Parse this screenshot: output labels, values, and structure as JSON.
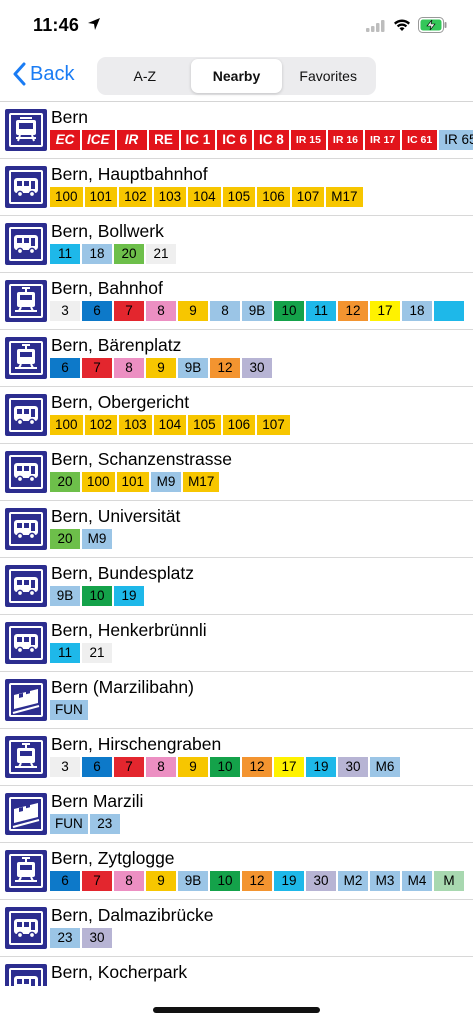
{
  "status": {
    "time": "11:46"
  },
  "nav": {
    "back_label": "Back",
    "tabs": [
      {
        "label": "A-Z",
        "active": false
      },
      {
        "label": "Nearby",
        "active": true
      },
      {
        "label": "Favorites",
        "active": false
      }
    ]
  },
  "colors": {
    "accent": "#1a7cf4",
    "icon_bg": "#2c2d8f",
    "sbb_red": "#e2141b"
  },
  "stops": [
    {
      "name": "Bern",
      "icon": "train-icon",
      "lines": [
        {
          "t": "EC",
          "c": "#e2141b",
          "cls": "red italic"
        },
        {
          "t": "ICE",
          "c": "#e2141b",
          "cls": "red italic"
        },
        {
          "t": "IR",
          "c": "#e2141b",
          "cls": "red italic"
        },
        {
          "t": "RE",
          "c": "#e2141b",
          "cls": "red"
        },
        {
          "t": "IC 1",
          "c": "#e2141b",
          "cls": "red"
        },
        {
          "t": "IC 6",
          "c": "#e2141b",
          "cls": "red"
        },
        {
          "t": "IC 8",
          "c": "#e2141b",
          "cls": "red"
        },
        {
          "t": "IR 15",
          "c": "#e2141b",
          "cls": "red small"
        },
        {
          "t": "IR 16",
          "c": "#e2141b",
          "cls": "red small"
        },
        {
          "t": "IR 17",
          "c": "#e2141b",
          "cls": "red small"
        },
        {
          "t": "IC 61",
          "c": "#e2141b",
          "cls": "red small"
        },
        {
          "t": "IR 65",
          "c": "#9bc5e6",
          "cls": "small"
        },
        {
          "t": "",
          "c": "#1a3a8c",
          "cls": ""
        }
      ]
    },
    {
      "name": "Bern, Hauptbahnhof",
      "icon": "bus-icon",
      "lines": [
        {
          "t": "100",
          "c": "#f7c600"
        },
        {
          "t": "101",
          "c": "#f7c600"
        },
        {
          "t": "102",
          "c": "#f7c600"
        },
        {
          "t": "103",
          "c": "#f7c600"
        },
        {
          "t": "104",
          "c": "#f7c600"
        },
        {
          "t": "105",
          "c": "#f7c600"
        },
        {
          "t": "106",
          "c": "#f7c600"
        },
        {
          "t": "107",
          "c": "#f7c600"
        },
        {
          "t": "M17",
          "c": "#f7c600"
        }
      ]
    },
    {
      "name": "Bern, Bollwerk",
      "icon": "bus-icon",
      "lines": [
        {
          "t": "11",
          "c": "#1eb8e9"
        },
        {
          "t": "18",
          "c": "#9bc5e6"
        },
        {
          "t": "20",
          "c": "#6dbf4a"
        },
        {
          "t": "21",
          "c": "#efefef"
        }
      ]
    },
    {
      "name": "Bern, Bahnhof",
      "icon": "tram-icon",
      "lines": [
        {
          "t": "3",
          "c": "#efefef"
        },
        {
          "t": "6",
          "c": "#0d79c9"
        },
        {
          "t": "7",
          "c": "#e3262e"
        },
        {
          "t": "8",
          "c": "#ec8fc2"
        },
        {
          "t": "9",
          "c": "#f7c600"
        },
        {
          "t": "8",
          "c": "#9bc5e6"
        },
        {
          "t": "9B",
          "c": "#9bc5e6"
        },
        {
          "t": "10",
          "c": "#14a24a"
        },
        {
          "t": "11",
          "c": "#1eb8e9"
        },
        {
          "t": "12",
          "c": "#f39430"
        },
        {
          "t": "17",
          "c": "#fff200"
        },
        {
          "t": "18",
          "c": "#9bc5e6"
        },
        {
          "t": "",
          "c": "#1eb8e9"
        }
      ]
    },
    {
      "name": "Bern, Bärenplatz",
      "icon": "tram-icon",
      "lines": [
        {
          "t": "6",
          "c": "#0d79c9"
        },
        {
          "t": "7",
          "c": "#e3262e"
        },
        {
          "t": "8",
          "c": "#ec8fc2"
        },
        {
          "t": "9",
          "c": "#f7c600"
        },
        {
          "t": "9B",
          "c": "#9bc5e6"
        },
        {
          "t": "12",
          "c": "#f39430"
        },
        {
          "t": "30",
          "c": "#b7b4d4"
        }
      ]
    },
    {
      "name": "Bern, Obergericht",
      "icon": "bus-icon",
      "lines": [
        {
          "t": "100",
          "c": "#f7c600"
        },
        {
          "t": "102",
          "c": "#f7c600"
        },
        {
          "t": "103",
          "c": "#f7c600"
        },
        {
          "t": "104",
          "c": "#f7c600"
        },
        {
          "t": "105",
          "c": "#f7c600"
        },
        {
          "t": "106",
          "c": "#f7c600"
        },
        {
          "t": "107",
          "c": "#f7c600"
        }
      ]
    },
    {
      "name": "Bern, Schanzenstrasse",
      "icon": "bus-icon",
      "lines": [
        {
          "t": "20",
          "c": "#6dbf4a"
        },
        {
          "t": "100",
          "c": "#f7c600"
        },
        {
          "t": "101",
          "c": "#f7c600"
        },
        {
          "t": "M9",
          "c": "#9bc5e6"
        },
        {
          "t": "M17",
          "c": "#f7c600"
        }
      ]
    },
    {
      "name": "Bern, Universität",
      "icon": "bus-icon",
      "lines": [
        {
          "t": "20",
          "c": "#6dbf4a"
        },
        {
          "t": "M9",
          "c": "#9bc5e6"
        }
      ]
    },
    {
      "name": "Bern, Bundesplatz",
      "icon": "bus-icon",
      "lines": [
        {
          "t": "9B",
          "c": "#9bc5e6"
        },
        {
          "t": "10",
          "c": "#14a24a"
        },
        {
          "t": "19",
          "c": "#1eb8e9"
        }
      ]
    },
    {
      "name": "Bern, Henkerbrünnli",
      "icon": "bus-icon",
      "lines": [
        {
          "t": "11",
          "c": "#1eb8e9"
        },
        {
          "t": "21",
          "c": "#efefef"
        }
      ]
    },
    {
      "name": "Bern (Marzilibahn)",
      "icon": "funicular-icon",
      "lines": [
        {
          "t": "FUN",
          "c": "#9bc5e6"
        }
      ]
    },
    {
      "name": "Bern, Hirschengraben",
      "icon": "tram-icon",
      "lines": [
        {
          "t": "3",
          "c": "#efefef"
        },
        {
          "t": "6",
          "c": "#0d79c9"
        },
        {
          "t": "7",
          "c": "#e3262e"
        },
        {
          "t": "8",
          "c": "#ec8fc2"
        },
        {
          "t": "9",
          "c": "#f7c600"
        },
        {
          "t": "10",
          "c": "#14a24a"
        },
        {
          "t": "12",
          "c": "#f39430"
        },
        {
          "t": "17",
          "c": "#fff200"
        },
        {
          "t": "19",
          "c": "#1eb8e9"
        },
        {
          "t": "30",
          "c": "#b7b4d4"
        },
        {
          "t": "M6",
          "c": "#9bc5e6"
        }
      ]
    },
    {
      "name": "Bern Marzili",
      "icon": "funicular-icon",
      "lines": [
        {
          "t": "FUN",
          "c": "#9bc5e6"
        },
        {
          "t": "23",
          "c": "#9bc5e6"
        }
      ]
    },
    {
      "name": "Bern, Zytglogge",
      "icon": "tram-icon",
      "lines": [
        {
          "t": "6",
          "c": "#0d79c9"
        },
        {
          "t": "7",
          "c": "#e3262e"
        },
        {
          "t": "8",
          "c": "#ec8fc2"
        },
        {
          "t": "9",
          "c": "#f7c600"
        },
        {
          "t": "9B",
          "c": "#9bc5e6"
        },
        {
          "t": "10",
          "c": "#14a24a"
        },
        {
          "t": "12",
          "c": "#f39430"
        },
        {
          "t": "19",
          "c": "#1eb8e9"
        },
        {
          "t": "30",
          "c": "#b7b4d4"
        },
        {
          "t": "M2",
          "c": "#9bc5e6"
        },
        {
          "t": "M3",
          "c": "#9bc5e6"
        },
        {
          "t": "M4",
          "c": "#9bc5e6"
        },
        {
          "t": "M",
          "c": "#a8d8b0"
        }
      ]
    },
    {
      "name": "Bern, Dalmazibrücke",
      "icon": "bus-icon",
      "lines": [
        {
          "t": "23",
          "c": "#9bc5e6"
        },
        {
          "t": "30",
          "c": "#b7b4d4"
        }
      ]
    },
    {
      "name": "Bern, Kocherpark",
      "icon": "bus-icon",
      "lines": []
    }
  ]
}
